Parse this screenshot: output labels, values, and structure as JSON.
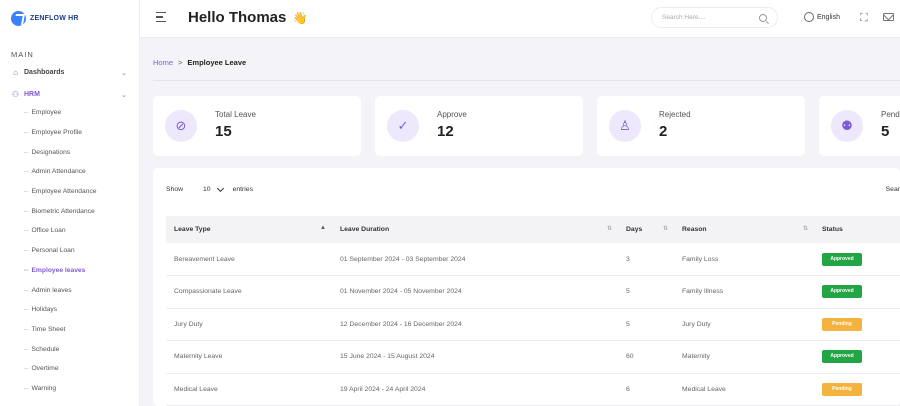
{
  "brand": {
    "logo_text": "ZENFLOW HR"
  },
  "sidebar": {
    "section": "MAIN",
    "top_items": [
      {
        "label": "Dashboards",
        "icon": "home-icon"
      },
      {
        "label": "HRM",
        "icon": "users-icon",
        "active": true
      }
    ],
    "sub_items": [
      "Employee",
      "Employee Profile",
      "Designations",
      "Admin Attendance",
      "Employee Attendance",
      "Biometric Attendance",
      "Office Loan",
      "Personal Loan",
      "Employee leaves",
      "Admin leaves",
      "Holidays",
      "Time Sheet",
      "Schedule",
      "Overtime",
      "Warning"
    ],
    "active_sub": "Employee leaves"
  },
  "header": {
    "greeting": "Hello Thomas",
    "wave": "👋",
    "search_placeholder": "Search Here....",
    "language": "English"
  },
  "breadcrumb": {
    "home": "Home",
    "separator": ">",
    "current": "Employee Leave"
  },
  "stats": [
    {
      "label": "Total Leave",
      "value": "15",
      "icon": "ban-icon"
    },
    {
      "label": "Approve",
      "value": "12",
      "icon": "check-circle-icon"
    },
    {
      "label": "Rejected",
      "value": "2",
      "icon": "user-icon"
    },
    {
      "label": "Pend",
      "value": "5",
      "icon": "user-clock-icon"
    }
  ],
  "table_controls": {
    "show": "Show",
    "entries_value": "10",
    "entries": "entries",
    "search": "Sear"
  },
  "table": {
    "headers": [
      "Leave Type",
      "Leave Duration",
      "Days",
      "Reason",
      "Status"
    ],
    "rows": [
      {
        "type": "Bereavement Leave",
        "duration": "01 September 2024 - 03 September 2024",
        "days": "3",
        "reason": "Family Loss",
        "status": "Approved"
      },
      {
        "type": "Compassionate Leave",
        "duration": "01 November 2024 - 05 November 2024",
        "days": "5",
        "reason": "Family Illness",
        "status": "Approved"
      },
      {
        "type": "Jury Duty",
        "duration": "12 December 2024 - 16 December 2024",
        "days": "5",
        "reason": "Jury Duty",
        "status": "Pending"
      },
      {
        "type": "Maternity Leave",
        "duration": "15 June 2024 - 15 August 2024",
        "days": "60",
        "reason": "Maternity",
        "status": "Approved"
      },
      {
        "type": "Medical Leave",
        "duration": "19 April 2024 - 24 April 2024",
        "days": "6",
        "reason": "Medical Leave",
        "status": "Pending"
      }
    ]
  },
  "colors": {
    "accent": "#7c5cd6",
    "approved": "#22a544",
    "pending": "#f4b23e"
  }
}
